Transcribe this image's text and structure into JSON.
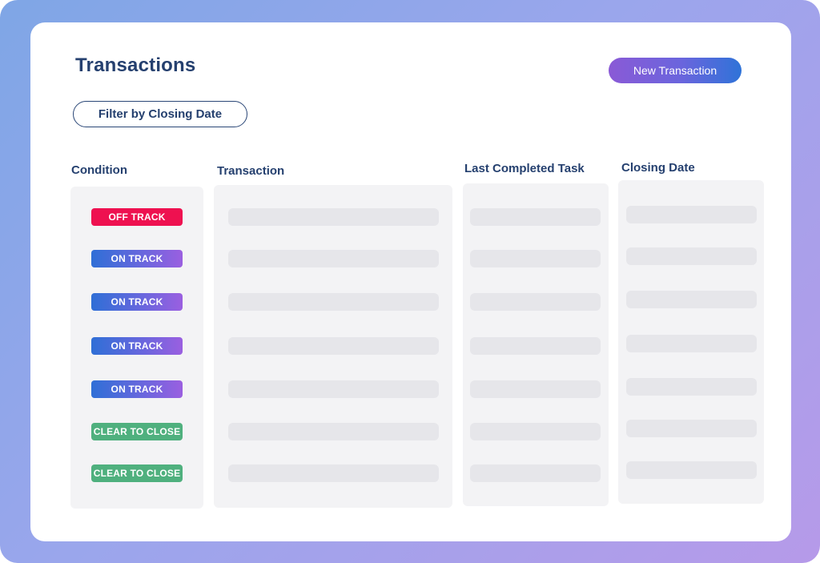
{
  "header": {
    "title": "Transactions",
    "new_button": "New Transaction",
    "filter_button": "Filter by Closing Date"
  },
  "columns": {
    "condition": "Condition",
    "transaction": "Transaction",
    "last_task": "Last Completed Task",
    "closing_date": "Closing Date"
  },
  "rows": [
    {
      "condition": "OFF TRACK",
      "status": "off"
    },
    {
      "condition": "ON TRACK",
      "status": "on"
    },
    {
      "condition": "ON TRACK",
      "status": "on"
    },
    {
      "condition": "ON TRACK",
      "status": "on"
    },
    {
      "condition": "ON TRACK",
      "status": "on"
    },
    {
      "condition": "CLEAR TO CLOSE",
      "status": "clear"
    },
    {
      "condition": "CLEAR TO CLOSE",
      "status": "clear"
    }
  ],
  "colors": {
    "off_track": "#ee1150",
    "on_track_start": "#2f6fd6",
    "on_track_end": "#9a5fe0",
    "clear_to_close": "#4fb07e",
    "heading": "#25406f"
  }
}
